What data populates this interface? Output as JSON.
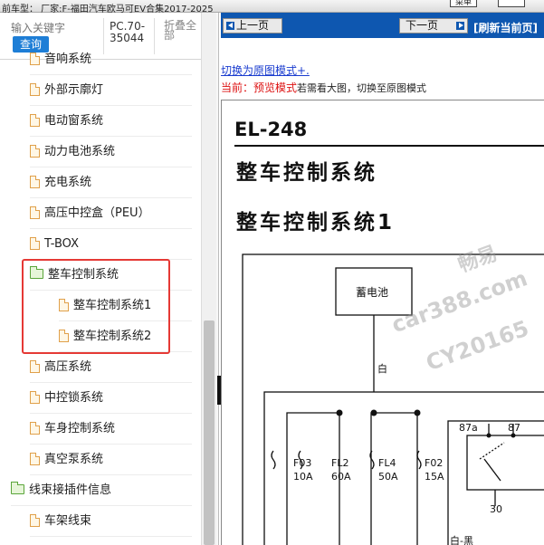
{
  "window": {
    "title": "前车型：  厂家:F-福田汽车欧马可EV合集2017-2025",
    "top_buttons": [
      "菜单",
      ""
    ]
  },
  "search": {
    "placeholder": "输入关键字",
    "button": "查询",
    "model_code": "PC.70-35044",
    "collapse_all": "折叠全部"
  },
  "tree": [
    {
      "label": "音响系统",
      "type": "file",
      "indent": 1
    },
    {
      "label": "外部示廓灯",
      "type": "file",
      "indent": 1
    },
    {
      "label": "电动窗系统",
      "type": "file",
      "indent": 1
    },
    {
      "label": "动力电池系统",
      "type": "file",
      "indent": 1
    },
    {
      "label": "充电系统",
      "type": "file",
      "indent": 1
    },
    {
      "label": "高压中控盒（PEU）",
      "type": "file",
      "indent": 1
    },
    {
      "label": "T-BOX",
      "type": "file",
      "indent": 1
    },
    {
      "label": "整车控制系统",
      "type": "folder-open",
      "indent": 1
    },
    {
      "label": "整车控制系统1",
      "type": "file",
      "indent": 2
    },
    {
      "label": "整车控制系统2",
      "type": "file",
      "indent": 2
    },
    {
      "label": "高压系统",
      "type": "file",
      "indent": 1
    },
    {
      "label": "中控锁系统",
      "type": "file",
      "indent": 1
    },
    {
      "label": "车身控制系统",
      "type": "file",
      "indent": 1
    },
    {
      "label": "真空泵系统",
      "type": "file",
      "indent": 1
    },
    {
      "label": "线束接插件信息",
      "type": "folder-open",
      "indent": 0
    },
    {
      "label": "车架线束",
      "type": "file",
      "indent": 1
    }
  ],
  "nav": {
    "prev": "上一页",
    "next": "下一页",
    "refresh": "[刷新当前页]"
  },
  "mode": {
    "switch_link": "切换为原图模式+.",
    "current_prefix": "当前：",
    "current_mode": "预览模式",
    "hint": "若需看大图，切换至原图模式"
  },
  "document": {
    "page_no": "EL-248",
    "title": "整车控制系统",
    "subtitle": "整车控制系统1",
    "battery_label": "蓄电池",
    "wire_color_white": "白",
    "wire_color_white_black": "白-黑",
    "fuses": [
      {
        "name": "F03",
        "rating": "10A"
      },
      {
        "name": "FL2",
        "rating": "60A"
      },
      {
        "name": "FL4",
        "rating": "50A"
      },
      {
        "name": "F02",
        "rating": "15A"
      }
    ],
    "relay_pins": [
      "87a",
      "87",
      "30"
    ],
    "watermark": [
      "畅易",
      "car388.com",
      "CY20165"
    ]
  },
  "colors": {
    "nav_blue": "#0e57b0",
    "highlight_red": "#e53935",
    "query_blue": "#1e7ed6"
  }
}
